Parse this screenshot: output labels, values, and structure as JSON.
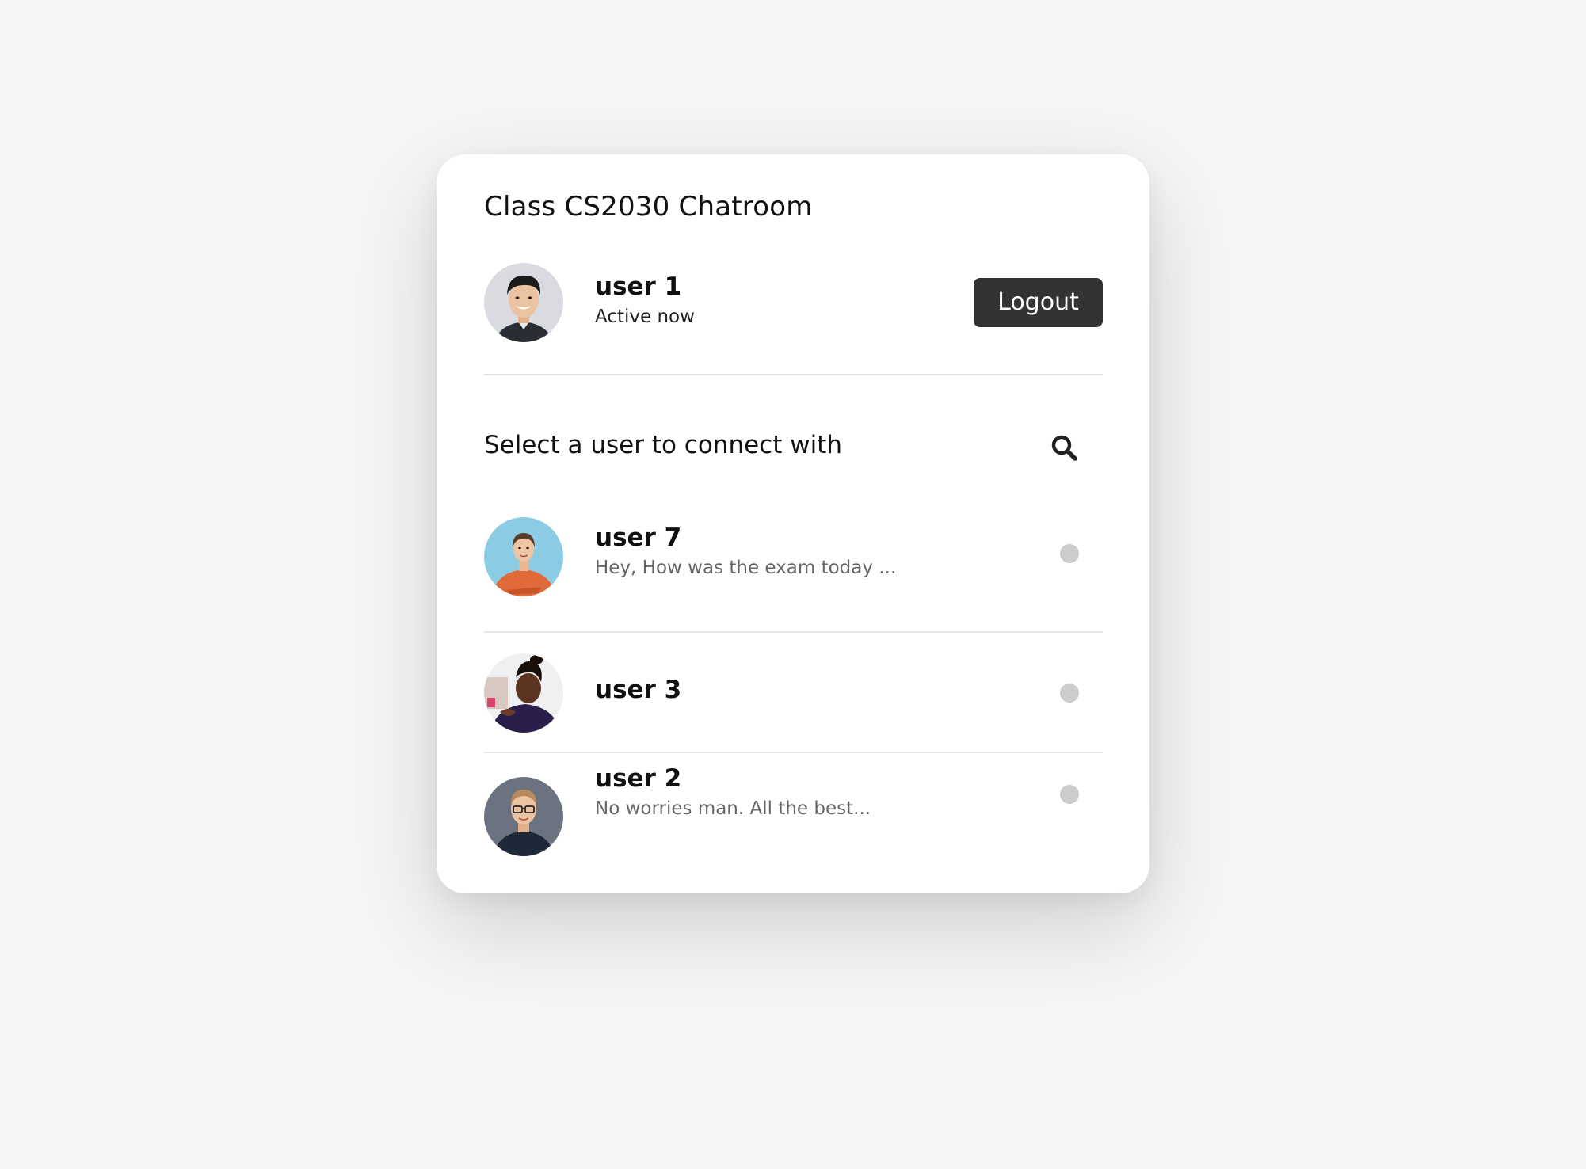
{
  "app": {
    "title": "Class CS2030 Chatroom"
  },
  "current_user": {
    "name": "user 1",
    "status": "Active now",
    "avatar": "avatar-user-1"
  },
  "header": {
    "logout_label": "Logout"
  },
  "search": {
    "prompt": "Select a user to connect with",
    "icon": "search-icon"
  },
  "users": [
    {
      "name": "user 7",
      "message": "Hey, How was the exam today ...",
      "status_color": "#cccccc",
      "online": false
    },
    {
      "name": "user 3",
      "message": "",
      "status_color": "#cccccc",
      "online": false
    },
    {
      "name": "user 2",
      "message": "No worries man. All the best...",
      "status_color": "#cccccc",
      "online": false
    }
  ],
  "colors": {
    "page_background": "#f6f6f6",
    "card_background": "#ffffff",
    "button_background": "#333333",
    "status_dot": "#cccccc"
  }
}
